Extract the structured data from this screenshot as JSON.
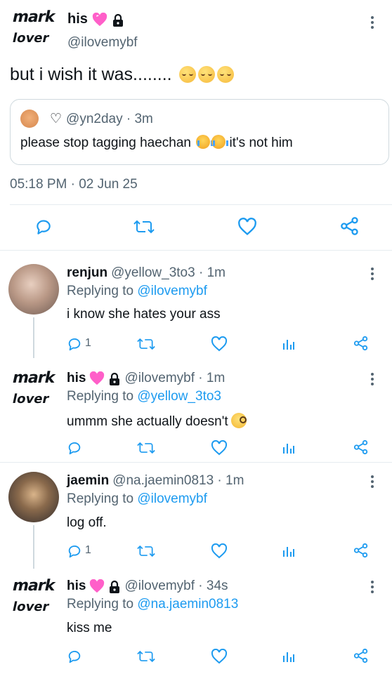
{
  "main_tweet": {
    "avatar_line1": "mark",
    "avatar_line2": "lover",
    "display_name": "his",
    "handle": "@ilovemybf",
    "text": "but i wish it was........",
    "timestamp": "05:18 PM · 02 Jun 25",
    "quoted": {
      "handle_time": "@yn2day · 3m",
      "heart_symbol": "♡",
      "text_before": "please stop tagging haechan",
      "text_after": "it's not him"
    }
  },
  "replies": [
    {
      "name": "renjun",
      "meta": "@yellow_3to3 · 1m",
      "replying_prefix": "Replying to",
      "replying_to": "@ilovemybf",
      "text": "i know she hates your ass",
      "reply_count": "1"
    },
    {
      "avatar_line1": "mark",
      "avatar_line2": "lover",
      "name": "his",
      "meta": "@ilovemybf · 1m",
      "replying_prefix": "Replying to",
      "replying_to": "@yellow_3to3",
      "text": "ummm she actually doesn't",
      "reply_count": ""
    },
    {
      "name": "jaemin",
      "meta": "@na.jaemin0813 · 1m",
      "replying_prefix": "Replying to",
      "replying_to": "@ilovemybf",
      "text": "log off.",
      "reply_count": "1"
    },
    {
      "avatar_line1": "mark",
      "avatar_line2": "lover",
      "name": "his",
      "meta": "@ilovemybf · 34s",
      "replying_prefix": "Replying to",
      "replying_to": "@na.jaemin0813",
      "text": "kiss me",
      "reply_count": ""
    }
  ],
  "colors": {
    "link": "#1d9bf0",
    "muted": "#536471",
    "icon": "#1d9bf0",
    "pink_heart": "#ff5fc9"
  },
  "icons": [
    "reply-icon",
    "retweet-icon",
    "like-icon",
    "share-icon",
    "stats-icon",
    "more-icon",
    "lock-icon",
    "pink-heart-icon"
  ]
}
